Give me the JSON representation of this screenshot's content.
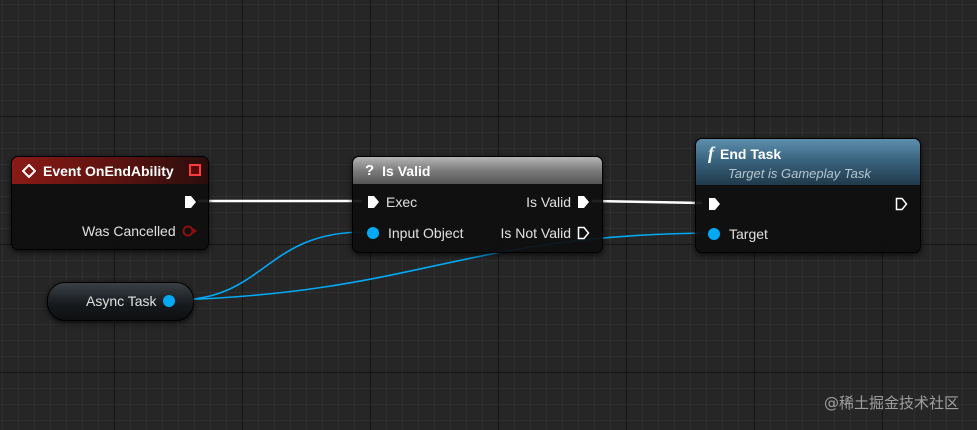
{
  "nodes": {
    "event": {
      "title": "Event OnEndAbility",
      "output_label": "Was Cancelled"
    },
    "is_valid": {
      "title": "Is Valid",
      "exec_label": "Exec",
      "input_label": "Input Object",
      "valid_label": "Is Valid",
      "not_valid_label": "Is Not Valid"
    },
    "end_task": {
      "title": "End Task",
      "subtitle": "Target is Gameplay Task",
      "target_label": "Target"
    },
    "variable": {
      "label": "Async Task"
    }
  },
  "colors": {
    "exec": "#ffffff",
    "object": "#03a9f4",
    "event_header": "#8a1a16",
    "bool_pin": "#8b0f0f"
  },
  "icons": {
    "event": "event-diamond-icon",
    "function": "function-f-icon",
    "macro": "question-mark-icon"
  },
  "watermark": "@稀土掘金技术社区"
}
